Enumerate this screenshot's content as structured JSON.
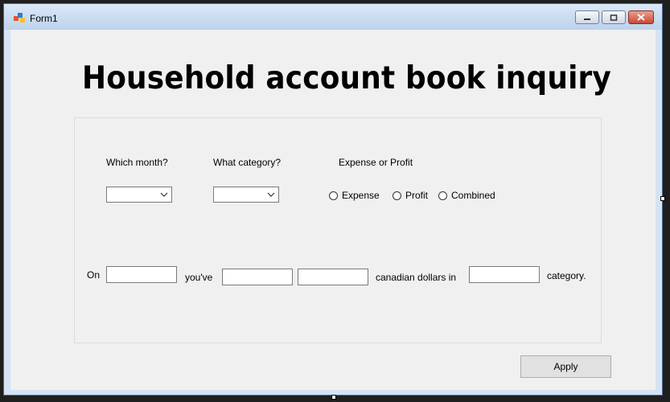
{
  "window": {
    "title": "Form1"
  },
  "form": {
    "heading": "Household account book inquiry",
    "month_label": "Which month?",
    "category_label": "What category?",
    "type_label": "Expense or Profit",
    "radios": [
      {
        "label": "Expense"
      },
      {
        "label": "Profit"
      },
      {
        "label": "Combined"
      }
    ],
    "sentence": {
      "on": "On",
      "youve": "you've",
      "canadian": "canadian dollars in",
      "category": "category."
    },
    "apply_label": "Apply"
  }
}
